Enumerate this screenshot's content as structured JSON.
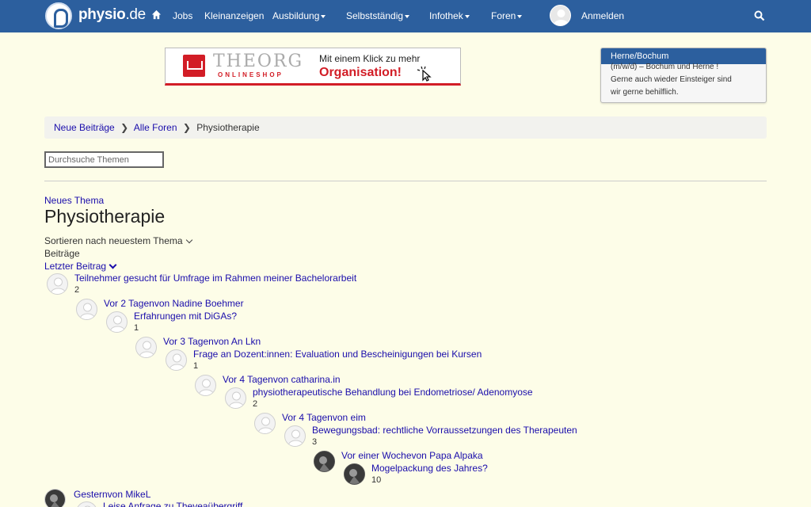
{
  "nav": {
    "brand_name": "physio",
    "brand_tld": ".de",
    "home_icon": "home-icon",
    "jobs": "Jobs",
    "classifieds": "Kleinanzeigen",
    "education": "Ausbildung",
    "selfemployed": "Selbstständig",
    "infothek": "Infothek",
    "forums": "Foren",
    "login": "Anmelden",
    "search_icon": "search-icon",
    "bar_color": "#2c5f9e"
  },
  "ad": {
    "brand": "THEORG",
    "subbrand": "ONLINESHOP",
    "line1": "Mit einem Klick zu mehr",
    "line2": "Organisation!",
    "accent_color": "#d21d26"
  },
  "job_box": {
    "header": "Herne/Bochum",
    "lines": [
      "(m/w/d) – Bochum und Herne !",
      "Gerne auch wieder Einsteiger sind",
      "wir gerne behilflich."
    ]
  },
  "breadcrumb": {
    "new_posts": "Neue Beiträge",
    "all_forums": "Alle Foren",
    "current": "Physiotherapie"
  },
  "search": {
    "placeholder": "Durchsuche Themen"
  },
  "forum": {
    "new_topic": "Neues Thema",
    "title": "Physiotherapie",
    "sort_label": "Sortieren nach neuestem Thema",
    "posts_label": "Beiträge",
    "last_post_label": "Letzter Beitrag"
  },
  "topics": [
    {
      "title": "Teilnehmer gesucht für Umfrage im Rahmen meiner Bachelorarbeit",
      "count": "2",
      "meta": "Vor 2 Tagenvon Nadine Boehmer"
    },
    {
      "title": "Erfahrungen mit DiGAs?",
      "count": "1",
      "meta": "Vor 3 Tagenvon An Lkn"
    },
    {
      "title": "Frage an Dozent:innen: Evaluation und Bescheinigungen bei Kursen",
      "count": "1",
      "meta": "Vor 4 Tagenvon catharina.in"
    },
    {
      "title": "physiotherapeutische Behandlung bei Endometriose/ Adenomyose",
      "count": "2",
      "meta": "Vor 4 Tagenvon eim"
    },
    {
      "title": "Bewegungsbad: rechtliche Vorraussetzungen des Therapeuten",
      "count": "3",
      "meta": "Vor einer Wochevon Papa Alpaka"
    },
    {
      "title": "Mogelpackung des Jahres?",
      "count": "10",
      "meta": "Gesternvon MikeL"
    },
    {
      "title": "Leise Anfrage zu Theveaübergriff",
      "count": "",
      "meta": ""
    }
  ]
}
